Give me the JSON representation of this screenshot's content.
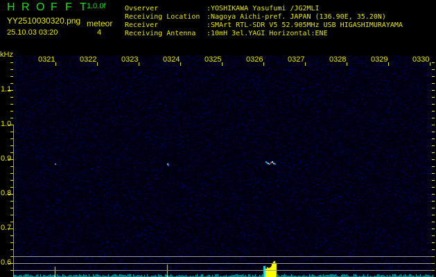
{
  "header": {
    "app_title": [
      "H",
      "R",
      "O",
      "F",
      "F",
      "T"
    ],
    "version": "1.0.0f",
    "filename": "YY2510030320.png",
    "datetime": "25.10.03 03:20",
    "meteor_label": "meteor",
    "meteor_count": "4"
  },
  "info": [
    {
      "label": "Ovserver",
      "value": ":YOSHIKAWA Yasufumi /JG2MLI"
    },
    {
      "label": "Receiving Location",
      "value": ":Nagoya Aichi-pref. JAPAN (136.90E, 35.20N)"
    },
    {
      "label": "Receiver",
      "value": ":SMArt RTL-SDR V5 52.905MHz USB HIGASHIMURAYAMA"
    },
    {
      "label": "Receiving Antenna",
      "value": ":10mH 3el.YAGI Horizontal:ENE"
    }
  ],
  "axis": {
    "y_unit": "kHz",
    "y_labels": [
      "1.1",
      "1.0",
      "0.9",
      "0.8",
      "0.7",
      "0.6"
    ],
    "time_labels": [
      "0321",
      "0322",
      "0323",
      "0324",
      "0325",
      "0326",
      "0327",
      "0328",
      "0329",
      "0330"
    ]
  },
  "colors": {
    "text": "#e8e800",
    "title": "#22dd22",
    "noise": "#1a1a9a",
    "level": "#22e0e0"
  }
}
